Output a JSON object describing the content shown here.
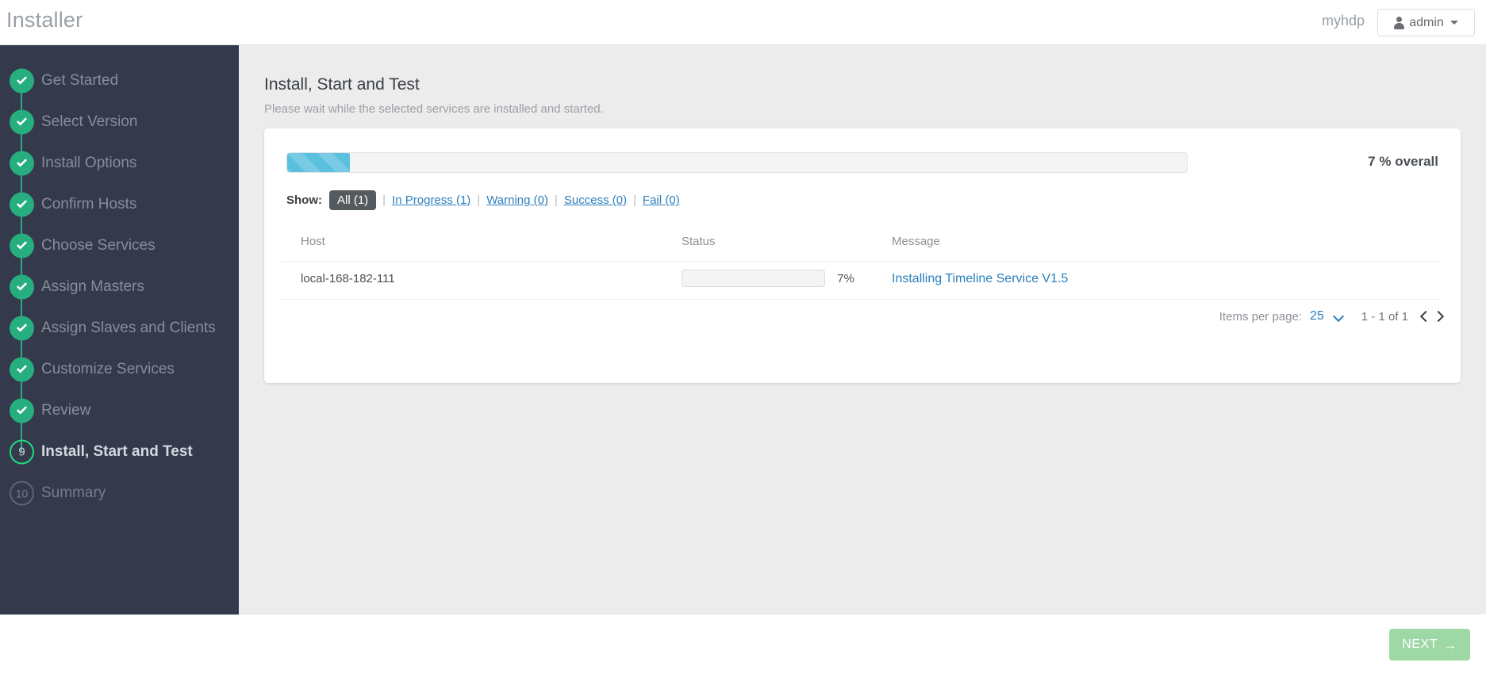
{
  "header": {
    "app_title": "Installer",
    "cluster_name": "myhdp",
    "user_label": "admin",
    "user_icon": "person-icon",
    "caret_icon": "caret-down-icon"
  },
  "sidebar": {
    "steps": [
      {
        "label": "Get Started",
        "state": "done",
        "marker": "check-icon"
      },
      {
        "label": "Select Version",
        "state": "done",
        "marker": "check-icon"
      },
      {
        "label": "Install Options",
        "state": "done",
        "marker": "check-icon"
      },
      {
        "label": "Confirm Hosts",
        "state": "done",
        "marker": "check-icon"
      },
      {
        "label": "Choose Services",
        "state": "done",
        "marker": "check-icon"
      },
      {
        "label": "Assign Masters",
        "state": "done",
        "marker": "check-icon"
      },
      {
        "label": "Assign Slaves and Clients",
        "state": "done",
        "marker": "check-icon"
      },
      {
        "label": "Customize Services",
        "state": "done",
        "marker": "check-icon"
      },
      {
        "label": "Review",
        "state": "done",
        "marker": "check-icon"
      },
      {
        "label": "Install, Start and Test",
        "state": "current",
        "marker": "9"
      },
      {
        "label": "Summary",
        "state": "todo",
        "marker": "10"
      }
    ]
  },
  "main": {
    "page_title": "Install, Start and Test",
    "page_subtitle": "Please wait while the selected services are installed and started.",
    "overall": {
      "percent": 7,
      "text": "7 % overall"
    },
    "filters": {
      "show_label": "Show:",
      "separator": "|",
      "items": [
        {
          "label": "All (1)",
          "active": true
        },
        {
          "label": "In Progress (1)",
          "active": false
        },
        {
          "label": "Warning (0)",
          "active": false
        },
        {
          "label": "Success (0)",
          "active": false
        },
        {
          "label": "Fail (0)",
          "active": false
        }
      ]
    },
    "table": {
      "columns": [
        "Host",
        "Status",
        "Message"
      ],
      "rows": [
        {
          "host": "local-168-182-111",
          "progress_percent": 7,
          "progress_text": "7%",
          "message": "Installing Timeline Service V1.5"
        }
      ]
    },
    "paginator": {
      "items_per_page_label": "Items per page:",
      "items_per_page_value": "25",
      "caret_icon": "chevron-down-icon",
      "range_label": "1 - 1 of 1",
      "prev_icon": "chevron-left-icon",
      "next_icon": "chevron-right-icon"
    }
  },
  "footer": {
    "next_label": "NEXT",
    "next_arrow": "→"
  },
  "colors": {
    "sidebar_bg": "#343a4c",
    "main_bg": "#ececec",
    "done_green": "#27ae7f",
    "current_green": "#1fd97c",
    "link_blue": "#2a7fbd",
    "overall_blue": "#5bc0de",
    "row_blue": "#3c7fbf",
    "next_green": "#9ed8a4"
  }
}
